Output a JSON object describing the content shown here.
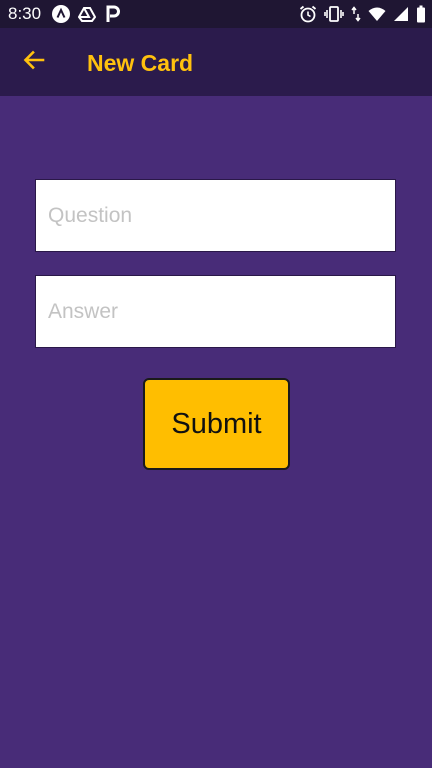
{
  "status_bar": {
    "time": "8:30",
    "left_icons": [
      "app-a-icon",
      "drive-icon",
      "p-app-icon"
    ],
    "right_icons": [
      "alarm-icon",
      "vibrate-icon",
      "data-arrows-icon",
      "wifi-icon",
      "signal-icon",
      "battery-icon"
    ]
  },
  "header": {
    "title": "New Card",
    "back_icon": "arrow-left-icon"
  },
  "form": {
    "question_placeholder": "Question",
    "answer_placeholder": "Answer",
    "submit_label": "Submit"
  },
  "colors": {
    "background": "#482c78",
    "app_bar": "#2b1b4c",
    "status_bar": "#1f1633",
    "accent": "#ffc10e",
    "button": "#ffbe00"
  }
}
